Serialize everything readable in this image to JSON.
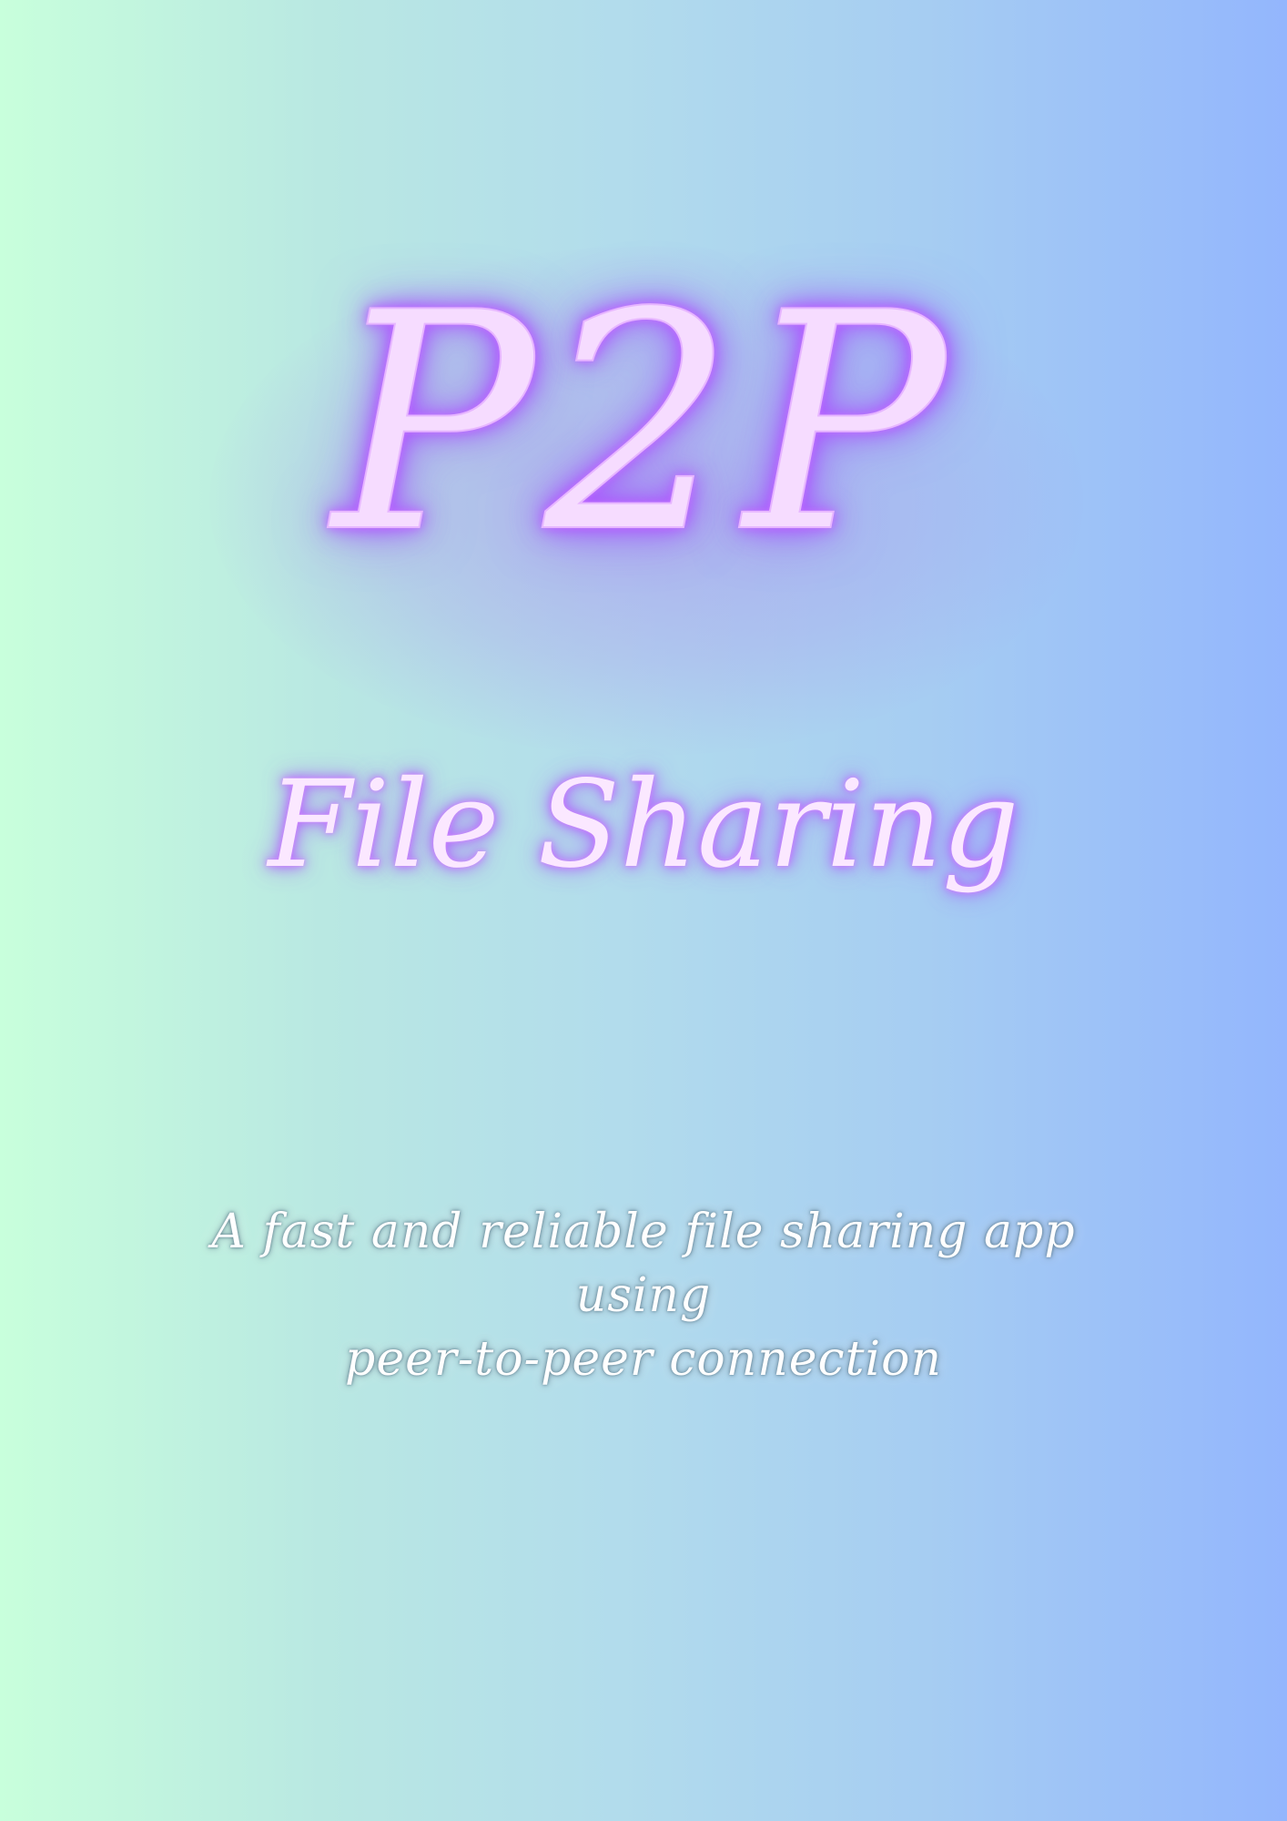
{
  "poster": {
    "title": "P2P",
    "subtitle": "File Sharing",
    "tagline": {
      "line1": "A fast and reliable file sharing app using",
      "line2": "peer-to-peer connection"
    }
  },
  "colors": {
    "background_left": "#c8ffdc",
    "background_right": "#93b6fd",
    "neon_text": "#f6dcff",
    "neon_glow": "#a64dff",
    "tagline_text": "#ffffff"
  }
}
